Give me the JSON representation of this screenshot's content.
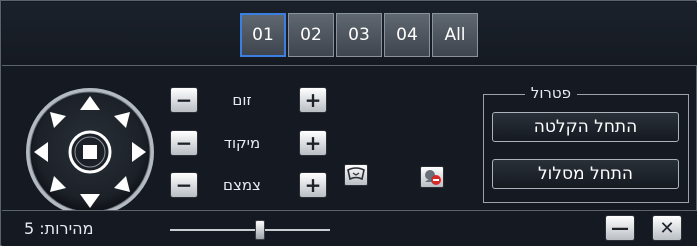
{
  "channels": {
    "tabs": [
      "01",
      "02",
      "03",
      "04",
      "All"
    ],
    "active_tab": "01"
  },
  "ptz": {
    "zoom_label": "זום",
    "focus_label": "מיקוד",
    "iris_label": "צמצם",
    "minus_symbol": "−",
    "plus_symbol": "+"
  },
  "patrol": {
    "title": "פטרול",
    "start_record_label": "התחל הקלטה",
    "start_route_label": "התחל מסלול"
  },
  "speed": {
    "label": "מהירות: 5",
    "value": 5
  },
  "window": {
    "minimize_symbol": "—",
    "close_symbol": "✕"
  },
  "icons": {
    "preset": "preset-icon",
    "clear": "clear-icon"
  },
  "colors": {
    "background": "#151a22",
    "accent_active_tab": "#3b7fe0",
    "button_face": "#ffffff"
  }
}
